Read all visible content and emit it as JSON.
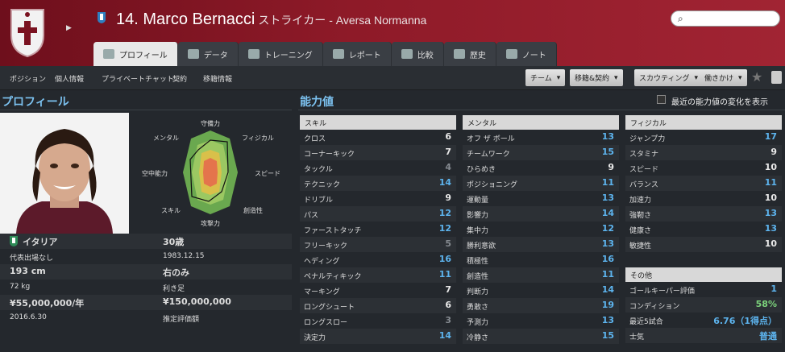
{
  "header": {
    "number": "14.",
    "name": "Marco Bernacci",
    "position": "ストライカー",
    "club": "- Aversa Normanna",
    "crest_text": "Aversa Normanna"
  },
  "tabs": [
    {
      "label": "プロフィール",
      "icon": "profile-icon",
      "active": true
    },
    {
      "label": "データ",
      "icon": "chart-icon",
      "active": false
    },
    {
      "label": "トレーニング",
      "icon": "football-icon",
      "active": false
    },
    {
      "label": "レポート",
      "icon": "report-icon",
      "active": false
    },
    {
      "label": "比較",
      "icon": "compare-icon",
      "active": false
    },
    {
      "label": "歴史",
      "icon": "history-icon",
      "active": false
    },
    {
      "label": "ノート",
      "icon": "note-icon",
      "active": false
    }
  ],
  "subnav": [
    "ポジション",
    "個人情報",
    "プライベートチャット",
    "契約",
    "移籍情報"
  ],
  "buttons": [
    "チーム",
    "移籍&契約",
    "スカウティング",
    "働きかけ"
  ],
  "profile": {
    "title": "プロフィール"
  },
  "radar": [
    "守備力",
    "フィジカル",
    "スピード",
    "創造性",
    "攻撃力",
    "スキル",
    "空中能力",
    "メンタル"
  ],
  "info": {
    "nationality": "イタリア",
    "age": "30歳",
    "caps": "代表出場なし",
    "dob": "1983.12.15",
    "height": "193 cm",
    "foot": "右のみ",
    "weight": "72 kg",
    "foot_label": "利き足",
    "wage": "¥55,000,000/年",
    "value": "¥150,000,000",
    "contract": "2016.6.30",
    "value_label": "推定評価額"
  },
  "attributes": {
    "title": "能力値",
    "show_changes": "最近の能力値の変化を表示",
    "skill": {
      "header": "スキル",
      "rows": [
        [
          "クロス",
          "6"
        ],
        [
          "コーナーキック",
          "7"
        ],
        [
          "タックル",
          "4"
        ],
        [
          "テクニック",
          "14"
        ],
        [
          "ドリブル",
          "9"
        ],
        [
          "パス",
          "12"
        ],
        [
          "ファーストタッチ",
          "12"
        ],
        [
          "フリーキック",
          "5"
        ],
        [
          "ヘディング",
          "16"
        ],
        [
          "ペナルティキック",
          "11"
        ],
        [
          "マーキング",
          "7"
        ],
        [
          "ロングシュート",
          "6"
        ],
        [
          "ロングスロー",
          "3"
        ],
        [
          "決定力",
          "14"
        ]
      ]
    },
    "mental": {
      "header": "メンタル",
      "rows": [
        [
          "オフ ザ ボール",
          "13"
        ],
        [
          "チームワーク",
          "15"
        ],
        [
          "ひらめき",
          "9"
        ],
        [
          "ポジショニング",
          "11"
        ],
        [
          "運動量",
          "13"
        ],
        [
          "影響力",
          "14"
        ],
        [
          "集中力",
          "12"
        ],
        [
          "勝利意欲",
          "13"
        ],
        [
          "積極性",
          "16"
        ],
        [
          "創造性",
          "11"
        ],
        [
          "判断力",
          "14"
        ],
        [
          "勇敢さ",
          "19"
        ],
        [
          "予測力",
          "13"
        ],
        [
          "冷静さ",
          "15"
        ]
      ]
    },
    "physical": {
      "header": "フィジカル",
      "rows": [
        [
          "ジャンプ力",
          "17"
        ],
        [
          "スタミナ",
          "9"
        ],
        [
          "スピード",
          "10"
        ],
        [
          "バランス",
          "11"
        ],
        [
          "加速力",
          "10"
        ],
        [
          "強靭さ",
          "13"
        ],
        [
          "健康さ",
          "13"
        ],
        [
          "敏捷性",
          "10"
        ]
      ]
    },
    "other": {
      "header": "その他",
      "rows": [
        [
          "ゴールキーパー評価",
          "1"
        ],
        [
          "コンディション",
          "58%"
        ],
        [
          "最近5試合",
          "6.76（1得点）"
        ],
        [
          "士気",
          "普通"
        ]
      ]
    }
  },
  "colors": {
    "header_red": "#8e1a28",
    "attr_blue": "#5db4ee",
    "attr_white": "#e8e8e8",
    "attr_grey": "#858a90"
  }
}
